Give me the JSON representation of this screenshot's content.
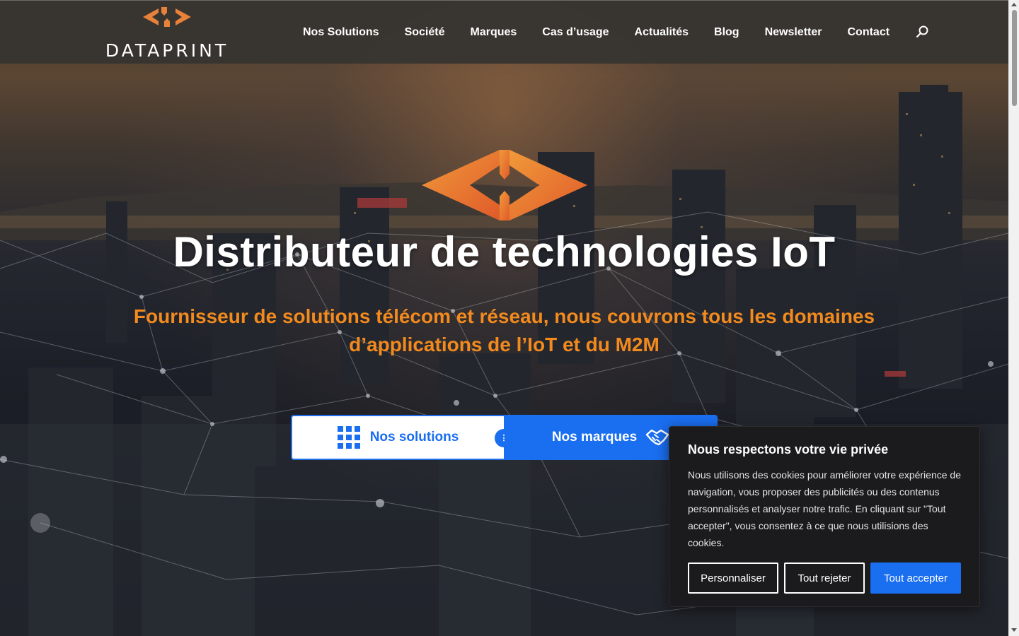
{
  "brand": {
    "name": "DATAPRINT",
    "accent": "#f28a1e",
    "primary_blue": "#1a6ef0"
  },
  "nav": {
    "items": [
      {
        "label": "Nos Solutions"
      },
      {
        "label": "Société"
      },
      {
        "label": "Marques"
      },
      {
        "label": "Cas d’usage"
      },
      {
        "label": "Actualités"
      },
      {
        "label": "Blog"
      },
      {
        "label": "Newsletter"
      },
      {
        "label": "Contact"
      }
    ],
    "search_icon": "search-icon"
  },
  "hero": {
    "title": "Distributeur de technologies IoT",
    "subtitle": "Fournisseur de solutions télécom et réseau, nous couvrons tous les domaines d’applications de l’IoT et du M2M",
    "cta_solutions": "Nos solutions",
    "cta_brands": "Nos marques",
    "cta_solutions_icon": "grid-icon",
    "cta_brands_icon": "handshake-icon"
  },
  "cookie_banner": {
    "title": "Nous respectons votre vie privée",
    "text": "Nous utilisons des cookies pour améliorer votre expérience de navigation, vous proposer des publicités ou des contenus personnalisés et analyser notre trafic. En cliquant sur \"Tout accepter\", vous consentez à ce que nous utilisions des cookies.",
    "customize_label": "Personnaliser",
    "reject_label": "Tout rejeter",
    "accept_label": "Tout accepter"
  }
}
